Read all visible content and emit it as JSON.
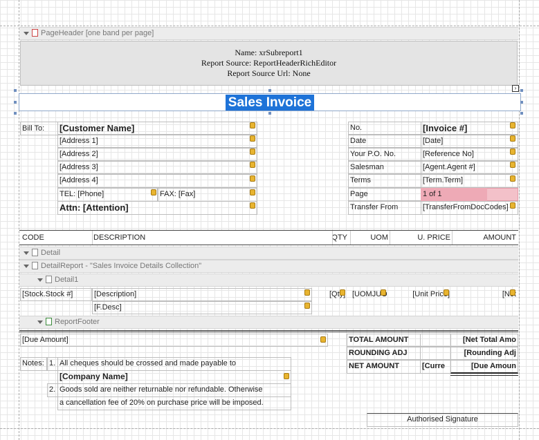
{
  "page_header": {
    "band_label": "PageHeader [one band per page]",
    "name_line": "Name: xrSubreport1",
    "source_line": "Report Source: ReportHeaderRichEditor",
    "url_line": "Report Source Url: None"
  },
  "title": "Sales Invoice",
  "bill_to": {
    "label": "Bill To:",
    "customer_name": "[Customer Name]",
    "address1": "[Address 1]",
    "address2": "[Address 2]",
    "address3": "[Address 3]",
    "address4": "[Address 4]",
    "tel": "TEL: [Phone]",
    "fax": "FAX: [Fax]",
    "attn": "Attn: [Attention]"
  },
  "invoice_info": {
    "rows": [
      {
        "label": "No.",
        "value": "[Invoice #]"
      },
      {
        "label": "Date",
        "value": "[Date]"
      },
      {
        "label": "Your P.O. No.",
        "value": "[Reference No]"
      },
      {
        "label": "Salesman",
        "value": "[Agent.Agent #]"
      },
      {
        "label": "Terms",
        "value": "[Term.Term]"
      },
      {
        "label": "Page",
        "value": "1 of 1"
      },
      {
        "label": "Transfer From",
        "value": "[TransferFromDocCodes]"
      }
    ]
  },
  "columns": {
    "code": "CODE",
    "description": "DESCRIPTION",
    "qty": "QTY",
    "uom": "UOM",
    "unit_price": "U. PRICE",
    "amount": "AMOUNT"
  },
  "bands": {
    "detail": "Detail",
    "detail_report": "DetailReport - \"Sales Invoice Details Collection\"",
    "detail1": "Detail1",
    "report_footer": "ReportFooter"
  },
  "detail_row": {
    "stock": "[Stock.Stock #]",
    "description": "[Description]",
    "fdesc": "[F.Desc]",
    "qty": "[Qty]",
    "uom": "[UOMJUOM]",
    "unit_price": "[Unit Price]",
    "net": "[Net"
  },
  "footer": {
    "due_amount": "[Due Amount]",
    "notes_label": "Notes:",
    "note1_num": "1.",
    "note1": "All cheques should be crossed and made payable to",
    "company_name": "[Company Name]",
    "note2_num": "2.",
    "note2a": "Goods sold are neither returnable nor refundable. Otherwise",
    "note2b": "a cancellation fee of 20% on purchase price will be imposed.",
    "total_amount_label": "TOTAL AMOUNT",
    "total_amount_value": "[Net Total Amo",
    "rounding_label": "ROUNDING ADJ",
    "rounding_value": "[Rounding Adj",
    "net_amount_label": "NET AMOUNT",
    "currency_value": "[Curre",
    "net_amount_value": "[Due Amoun",
    "signature": "Authorised Signature"
  },
  "colors": {
    "title_bg": "#1e73d8",
    "page_highlight": "#f3c1c9",
    "band_bg": "#ececec"
  }
}
